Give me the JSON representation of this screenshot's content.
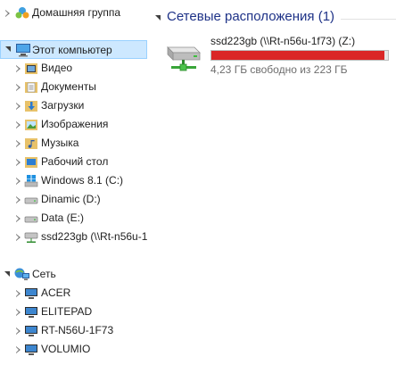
{
  "nav": {
    "homegroup": {
      "label": "Домашняя группа",
      "icon": "homegroup-icon"
    },
    "this_pc": {
      "label": "Этот компьютер",
      "icon": "computer-icon",
      "children": [
        {
          "label": "Видео",
          "icon": "video-folder-icon"
        },
        {
          "label": "Документы",
          "icon": "documents-folder-icon"
        },
        {
          "label": "Загрузки",
          "icon": "downloads-folder-icon"
        },
        {
          "label": "Изображения",
          "icon": "pictures-folder-icon"
        },
        {
          "label": "Музыка",
          "icon": "music-folder-icon"
        },
        {
          "label": "Рабочий стол",
          "icon": "desktop-folder-icon"
        },
        {
          "label": "Windows 8.1 (C:)",
          "icon": "windows-drive-icon"
        },
        {
          "label": "Dinamic (D:)",
          "icon": "hard-drive-icon"
        },
        {
          "label": "Data (E:)",
          "icon": "hard-drive-icon"
        },
        {
          "label": "ssd223gb (\\\\Rt-n56u-1",
          "icon": "network-drive-icon"
        }
      ]
    },
    "network": {
      "label": "Сеть",
      "icon": "network-icon",
      "children": [
        {
          "label": "ACER",
          "icon": "network-computer-icon"
        },
        {
          "label": "ELITEPAD",
          "icon": "network-computer-icon"
        },
        {
          "label": "RT-N56U-1F73",
          "icon": "network-computer-icon"
        },
        {
          "label": "VOLUMIO",
          "icon": "network-computer-icon"
        }
      ]
    }
  },
  "content": {
    "group_title": "Сетевые расположения (1)",
    "drive": {
      "name": "ssd223gb (\\\\Rt-n56u-1f73) (Z:)",
      "free_text": "4,23 ГБ свободно из 223 ГБ",
      "used_fraction": 0.981,
      "bar_color": "#da2626",
      "icon": "network-drive-icon"
    }
  },
  "colors": {
    "selection_bg": "#cde8ff",
    "selection_border": "#99d1ff",
    "group_title": "#1e3287"
  }
}
